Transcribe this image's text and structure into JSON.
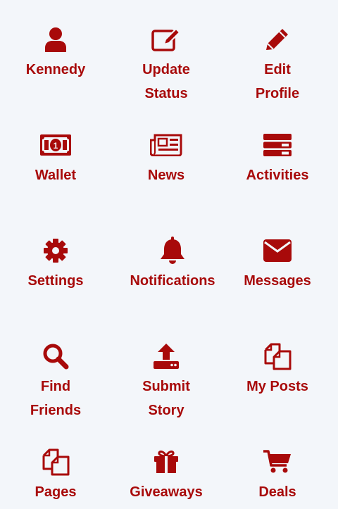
{
  "colors": {
    "accent": "#a80a0a",
    "background": "#f3f6fa"
  },
  "menu": {
    "items": [
      {
        "label": "Kennedy",
        "icon": "user-icon"
      },
      {
        "label": "Update Status",
        "icon": "edit-icon"
      },
      {
        "label": "Edit Profile",
        "icon": "pencil-icon"
      },
      {
        "label": "Wallet",
        "icon": "money-bill-icon"
      },
      {
        "label": "News",
        "icon": "newspaper-icon"
      },
      {
        "label": "Activities",
        "icon": "server-icon"
      },
      {
        "label": "Settings",
        "icon": "gear-icon"
      },
      {
        "label": "Notifications",
        "icon": "bell-icon"
      },
      {
        "label": "Messages",
        "icon": "envelope-icon"
      },
      {
        "label": "Find Friends",
        "icon": "search-icon"
      },
      {
        "label": "Submit Story",
        "icon": "upload-icon"
      },
      {
        "label": "My Posts",
        "icon": "copy-icon"
      },
      {
        "label": "Pages",
        "icon": "copy-icon"
      },
      {
        "label": "Giveaways",
        "icon": "gift-icon"
      },
      {
        "label": "Deals",
        "icon": "cart-icon"
      }
    ]
  }
}
